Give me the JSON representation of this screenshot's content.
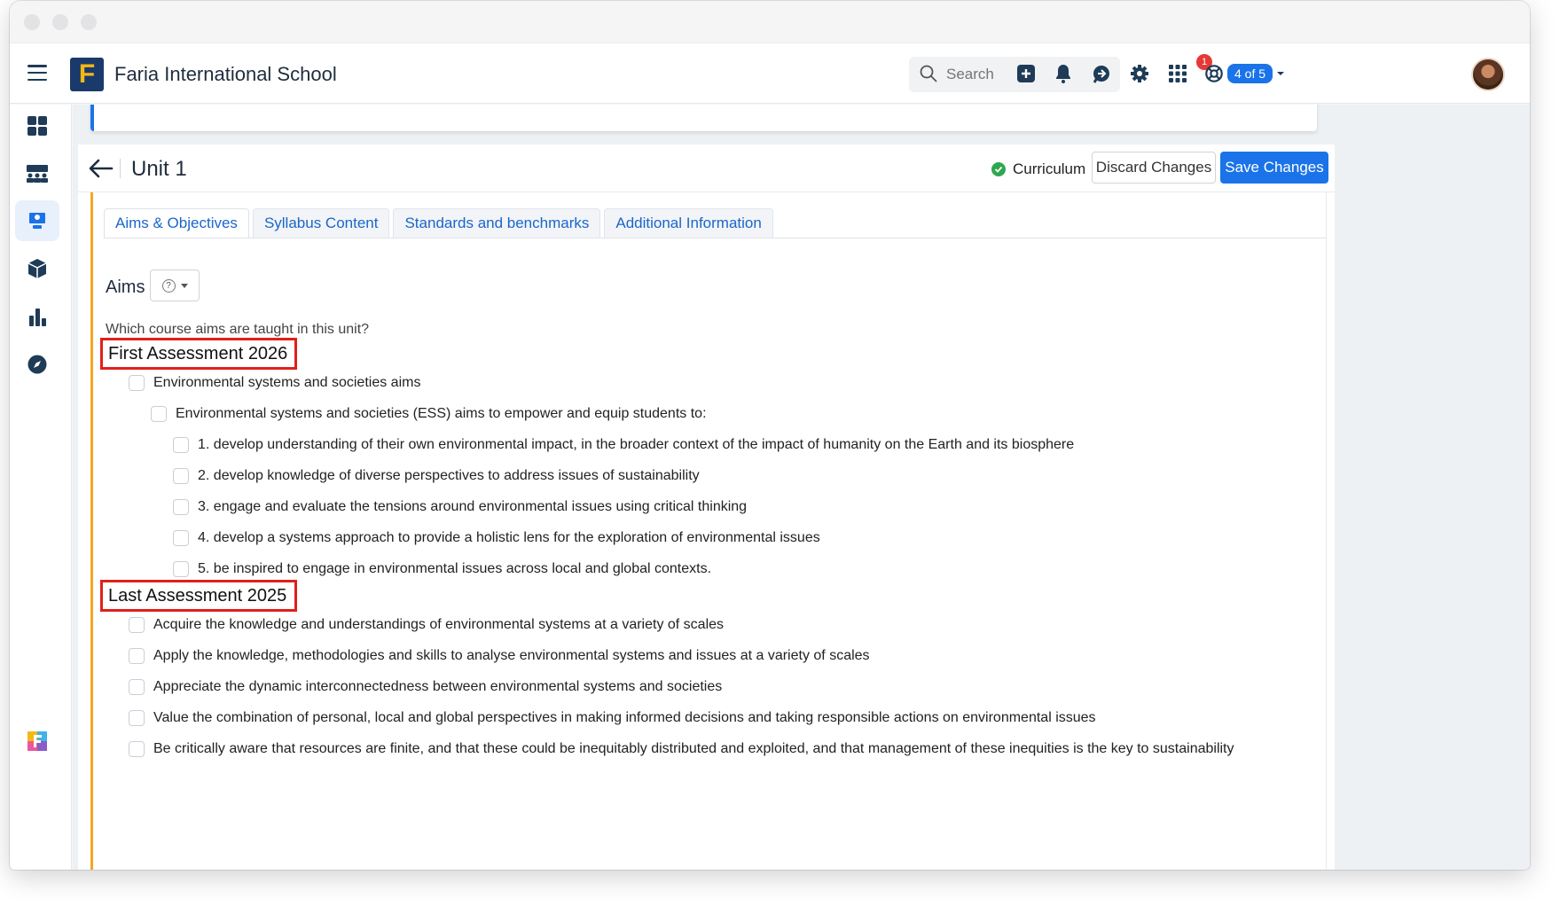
{
  "topbar": {
    "school_name": "Faria International School",
    "logo_letter": "F",
    "search_placeholder": "Search",
    "notification_count": "1",
    "pager_label": "4 of 5",
    "icons": [
      "menu-icon",
      "plus-square-icon",
      "bell-icon",
      "chat-icon",
      "gear-icon",
      "apps-grid-icon",
      "lifebuoy-icon"
    ]
  },
  "sidebar": {
    "items": [
      "dashboard-icon",
      "classes-icon",
      "curriculum-icon",
      "cube-icon",
      "bar-chart-icon",
      "compass-icon"
    ],
    "footer_icon": "faria-logo-icon"
  },
  "unit": {
    "title": "Unit 1",
    "status_label": "Curriculum",
    "discard_label": "Discard Changes",
    "save_label": "Save Changes"
  },
  "tabs": [
    {
      "label": "Aims & Objectives"
    },
    {
      "label": "Syllabus Content"
    },
    {
      "label": "Standards and benchmarks"
    },
    {
      "label": "Additional Information"
    }
  ],
  "aims": {
    "label": "Aims",
    "help_symbol": "?",
    "question": "Which course aims are taught in this unit?",
    "groups": [
      {
        "title": "First Assessment 2026",
        "items": [
          {
            "text": "Environmental systems and societies aims"
          },
          {
            "text": "Environmental systems and societies (ESS) aims to empower and equip students to:"
          },
          {
            "text": "1. develop understanding of their own environmental impact, in the broader context of the impact of humanity on the Earth and its biosphere"
          },
          {
            "text": "2. develop knowledge of diverse perspectives to address issues of sustainability"
          },
          {
            "text": "3. engage and evaluate the tensions around environmental issues using critical thinking"
          },
          {
            "text": "4. develop a systems approach to provide a holistic lens for the exploration of environmental issues"
          },
          {
            "text": "5. be inspired to engage in environmental issues across local and global contexts."
          }
        ]
      },
      {
        "title": "Last Assessment 2025",
        "items": [
          {
            "text": "Acquire the knowledge and understandings of environmental systems at a variety of scales"
          },
          {
            "text": "Apply the knowledge, methodologies and skills to analyse environmental systems and issues at a variety of scales"
          },
          {
            "text": "Appreciate the dynamic interconnectedness between environmental systems and societies"
          },
          {
            "text": "Value the combination of personal, local and global perspectives in making informed decisions and taking responsible actions on environmental issues"
          },
          {
            "text": "Be critically aware that resources are finite, and that these could be inequitably distributed and exploited, and that management of these inequities is the key to sustainability"
          }
        ]
      }
    ]
  },
  "colors": {
    "accent": "#1a73e8",
    "highlight_border": "#e0201a",
    "unit_stripe": "#f5a623",
    "status_ok": "#2ea84f"
  }
}
